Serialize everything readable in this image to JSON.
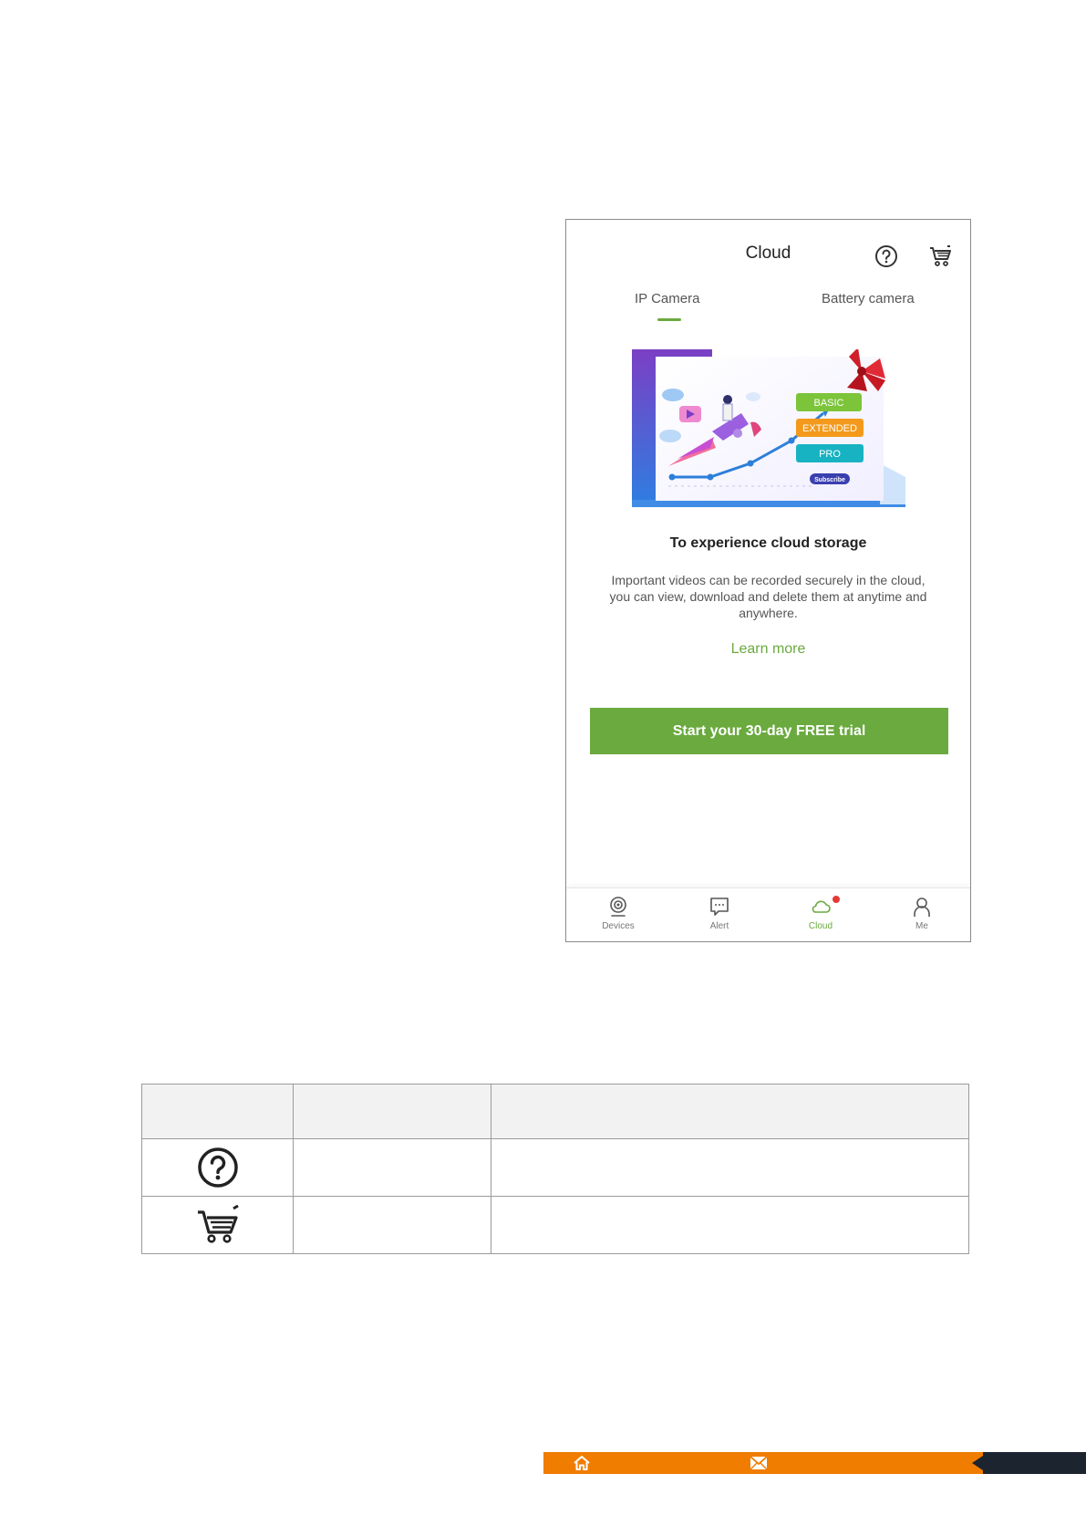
{
  "app": {
    "title": "Cloud",
    "header_icons": [
      "help-icon",
      "cart-icon"
    ]
  },
  "tabs": [
    {
      "label": "IP Camera",
      "active": true
    },
    {
      "label": "Battery camera",
      "active": false
    }
  ],
  "promo": {
    "plans": [
      "BASIC",
      "EXTENDED",
      "PRO"
    ],
    "subscribe_label": "Subscribe"
  },
  "content": {
    "headline": "To experience cloud storage",
    "description": "Important videos can be recorded securely in the cloud, you can view, download and delete them at anytime and anywhere.",
    "learn_more": "Learn more",
    "cta_label": "Start your 30-day FREE trial"
  },
  "bottom_nav": [
    {
      "label": "Devices",
      "icon": "camera-icon"
    },
    {
      "label": "Alert",
      "icon": "message-icon"
    },
    {
      "label": "Cloud",
      "icon": "cloud-icon",
      "active": true
    },
    {
      "label": "Me",
      "icon": "person-icon"
    }
  ],
  "table": {
    "rows": [
      {
        "icon": "help-icon"
      },
      {
        "icon": "cart-icon"
      }
    ]
  },
  "footer": {
    "icons": [
      "home-icon",
      "mail-icon"
    ]
  },
  "colors": {
    "accent_green": "#6aaa3e",
    "footer_orange": "#f07c00",
    "footer_dark": "#1c2430",
    "notification_red": "#e53935"
  }
}
